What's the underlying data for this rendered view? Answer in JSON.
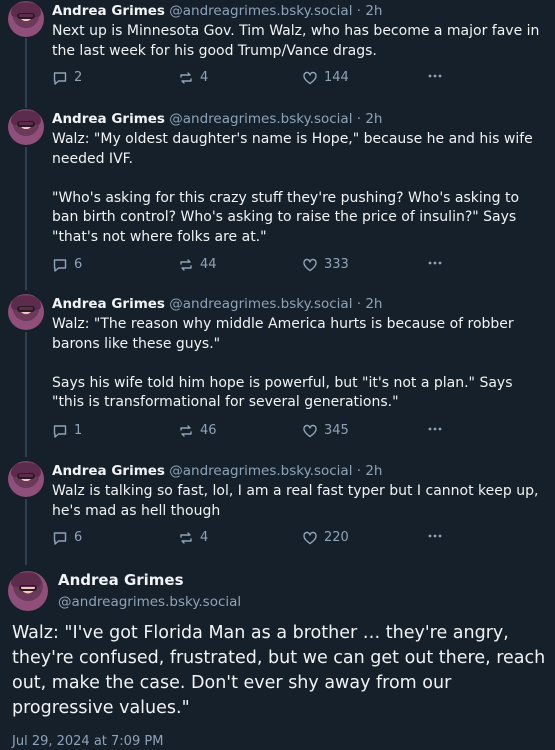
{
  "replies": [
    {
      "author": "Andrea Grimes",
      "handle": "@andreagrimes.bsky.social",
      "time": "2h",
      "text": "Next up is Minnesota Gov. Tim Walz, who has become a major fave in the last week for his good Trump/Vance drags.",
      "replies": "2",
      "reposts": "4",
      "likes": "144"
    },
    {
      "author": "Andrea Grimes",
      "handle": "@andreagrimes.bsky.social",
      "time": "2h",
      "text": "Walz: \"My oldest daughter's name is Hope,\" because he and his wife needed IVF.\n\n\"Who's asking for this crazy stuff they're pushing? Who's asking to ban birth control? Who's asking to raise the price of insulin?\" Says \"that's not where folks are at.\"",
      "replies": "6",
      "reposts": "44",
      "likes": "333"
    },
    {
      "author": "Andrea Grimes",
      "handle": "@andreagrimes.bsky.social",
      "time": "2h",
      "text": "Walz: \"The reason why middle America hurts is because of robber barons like these guys.\"\n\nSays his wife told him hope is powerful, but \"it's not a plan.\" Says \"this is transformational for several generations.\"",
      "replies": "1",
      "reposts": "46",
      "likes": "345"
    },
    {
      "author": "Andrea Grimes",
      "handle": "@andreagrimes.bsky.social",
      "time": "2h",
      "text": "Walz is talking so fast, lol, I am a real fast typer but I cannot keep up, he's mad as hell though",
      "replies": "6",
      "reposts": "4",
      "likes": "220"
    }
  ],
  "main_post": {
    "author": "Andrea Grimes",
    "handle": "@andreagrimes.bsky.social",
    "text": "Walz: \"I've got Florida Man as a brother … they're angry, they're confused, frustrated, but we can get out there, reach out, make the case. Don't ever shy away from our progressive values.\"",
    "timestamp": "Jul 29, 2024 at 7:09 PM"
  },
  "icons": {
    "reply": "speech-bubble-icon",
    "repost": "repost-arrows-icon",
    "like": "heart-icon",
    "more": "ellipsis-icon"
  },
  "colors": {
    "background": "#16202a",
    "text": "#f1f3f5",
    "muted": "#8fa3b8"
  }
}
